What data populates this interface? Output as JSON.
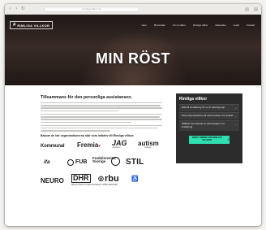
{
  "browser": {
    "nav_back": "‹",
    "nav_forward": "›",
    "nav_reload": "↻",
    "url": "rimligavillkor.se"
  },
  "site": {
    "logo_mark": "#",
    "logo_text": "RIMLIGA VILLKOR",
    "nav": [
      "Hem",
      "Bli kontakt",
      "Om & villkor",
      "Rimliga villkor",
      "Materialet",
      "Lokal",
      "Kontakt"
    ]
  },
  "hero": {
    "title": "MIN RÖST"
  },
  "main": {
    "heading": "Tillsammans för den personliga assistansen.",
    "partners_heading": "Bakom de här organisationerna står som initiativ till Rimliga villkor:"
  },
  "partners": {
    "kommunal": "Kommunal",
    "fremia": "Fremia",
    "jag": "JAG",
    "jag_sub": "i centrum",
    "autism": "autism",
    "autism_sub": "Sverige",
    "ifa": "ifa",
    "fub": "FUB",
    "funktionsratt_1": "Funktionsrätt",
    "funktionsratt_2": "Sverige",
    "stil": "STIL",
    "neuro": "NEURO",
    "dhr": "DHR",
    "dhr_sub": "DELAKTIGHET HANDLINGSKRAFT RÖRELSEFRIHET",
    "rbu": "rbu"
  },
  "sidebar": {
    "title": "Rimliga villkor",
    "items": [
      {
        "label": "Rätt till anställning för en fri arbetsgrupp",
        "chevron": "⌄"
      },
      {
        "label": "Personlig assistans på vad bemötes och avtalet",
        "chevron": "⌄"
      },
      {
        "label": "Hållbart bemötande av arbetstagare vid ersättning",
        "chevron": "⌄"
      }
    ],
    "cta": "SKRIV UNDER FÖR RIMLIGA VILLKOR",
    "cta_icon": "↗"
  }
}
